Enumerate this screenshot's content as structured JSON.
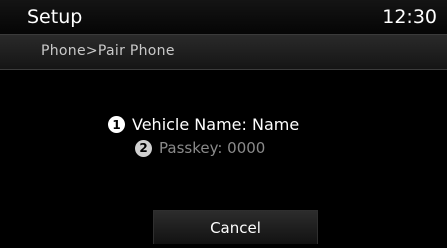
{
  "header": {
    "title": "Setup",
    "clock": "12:30"
  },
  "breadcrumb": "Phone>Pair Phone",
  "pairing_info": {
    "vehicle": {
      "step": "1",
      "text": "Vehicle Name: Name"
    },
    "passkey": {
      "step": "2",
      "text": "Passkey: 0000"
    }
  },
  "buttons": {
    "cancel": "Cancel"
  }
}
